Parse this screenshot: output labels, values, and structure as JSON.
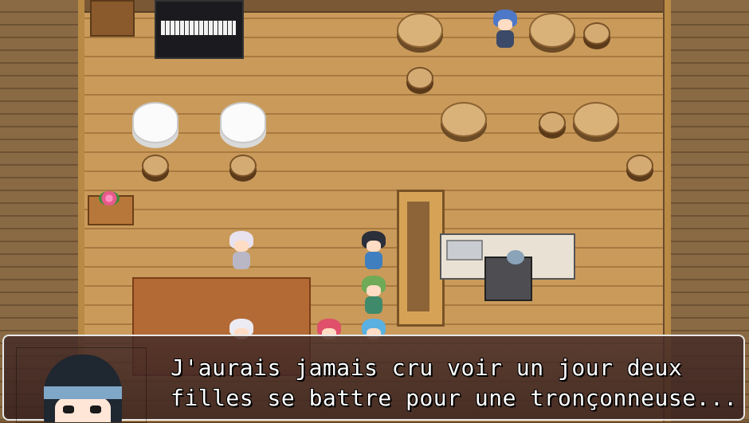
{
  "message": {
    "line1": "J'aurais jamais cru voir un jour deux",
    "line2": "filles se battre pour une tronçonneuse..."
  },
  "portrait": {
    "icon": "character-portrait"
  },
  "colors": {
    "floor": "#c99a5a",
    "message_bg": "#462c28",
    "message_border": "#e8e8e8",
    "text": "#ffffff"
  }
}
